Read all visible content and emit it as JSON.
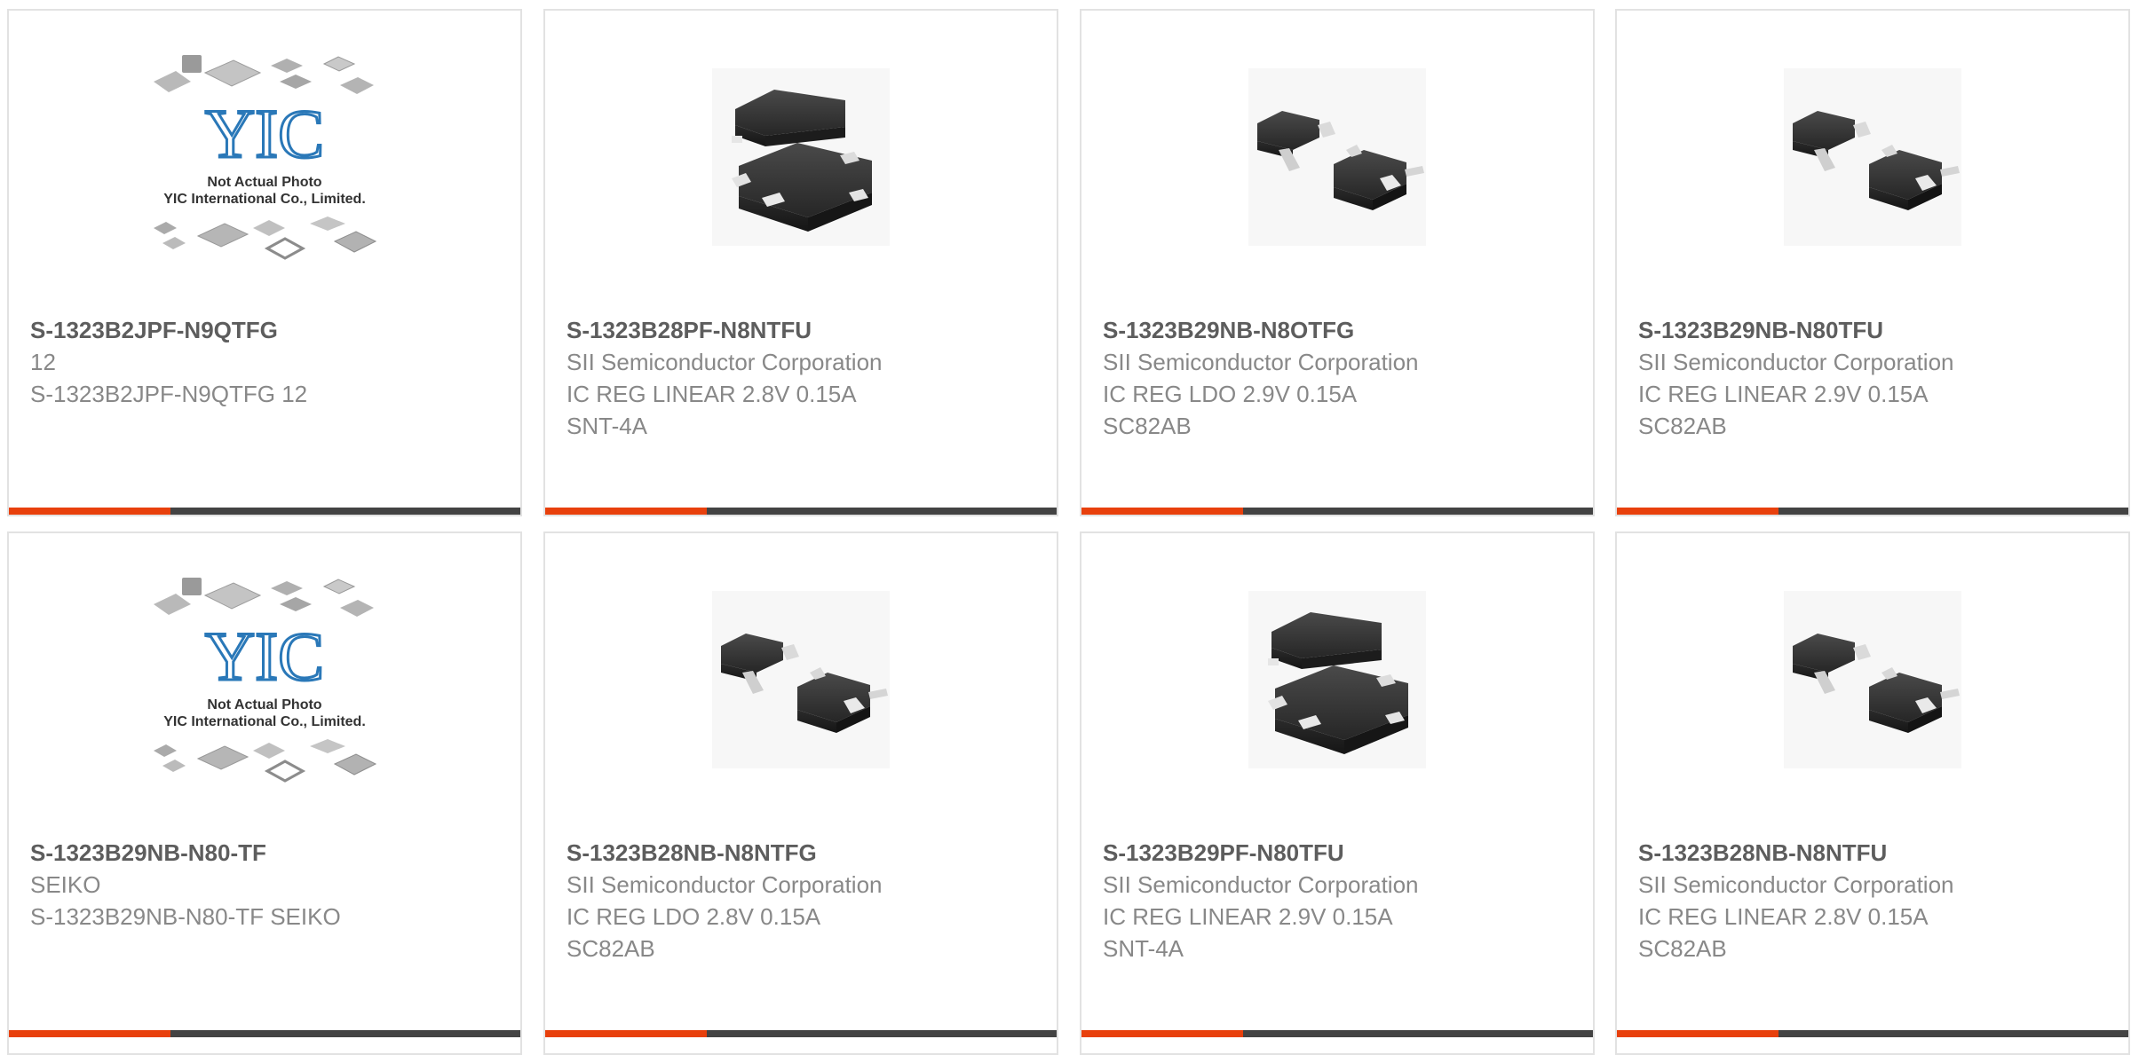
{
  "colors": {
    "accent": "#e8400c",
    "bar": "#434343",
    "border": "#e2e2e2",
    "title": "#5d5d5d",
    "text": "#888888",
    "logo_blue": "#2a78b8"
  },
  "placeholder": {
    "caption1": "Not Actual Photo",
    "caption2": "YIC International Co., Limited.",
    "logo": "YIC"
  },
  "products": [
    {
      "part": "S-1323B2JPF-N9QTFG",
      "lines": [
        "12",
        "S-1323B2JPF-N9QTFG 12"
      ],
      "image": "placeholder-image"
    },
    {
      "part": "S-1323B28PF-N8NTFU",
      "lines": [
        "SII Semiconductor Corporation",
        "IC REG LINEAR 2.8V 0.15A",
        "SNT-4A"
      ],
      "image": "snt-4a-chip-image"
    },
    {
      "part": "S-1323B29NB-N8OTFG",
      "lines": [
        "SII Semiconductor Corporation",
        "IC REG LDO 2.9V 0.15A",
        "SC82AB"
      ],
      "image": "sc82ab-chip-image"
    },
    {
      "part": "S-1323B29NB-N80TFU",
      "lines": [
        "SII Semiconductor Corporation",
        "IC REG LINEAR 2.9V 0.15A",
        "SC82AB"
      ],
      "image": "sc82ab-chip-image"
    },
    {
      "part": "S-1323B29NB-N80-TF",
      "lines": [
        "SEIKO",
        "S-1323B29NB-N80-TF SEIKO"
      ],
      "image": "placeholder-image"
    },
    {
      "part": "S-1323B28NB-N8NTFG",
      "lines": [
        "SII Semiconductor Corporation",
        "IC REG LDO 2.8V 0.15A",
        "SC82AB"
      ],
      "image": "sc82ab-chip-image"
    },
    {
      "part": "S-1323B29PF-N80TFU",
      "lines": [
        "SII Semiconductor Corporation",
        "IC REG LINEAR 2.9V 0.15A",
        "SNT-4A"
      ],
      "image": "snt-4a-chip-image"
    },
    {
      "part": "S-1323B28NB-N8NTFU",
      "lines": [
        "SII Semiconductor Corporation",
        "IC REG LINEAR 2.8V 0.15A",
        "SC82AB"
      ],
      "image": "sc82ab-chip-image"
    }
  ]
}
